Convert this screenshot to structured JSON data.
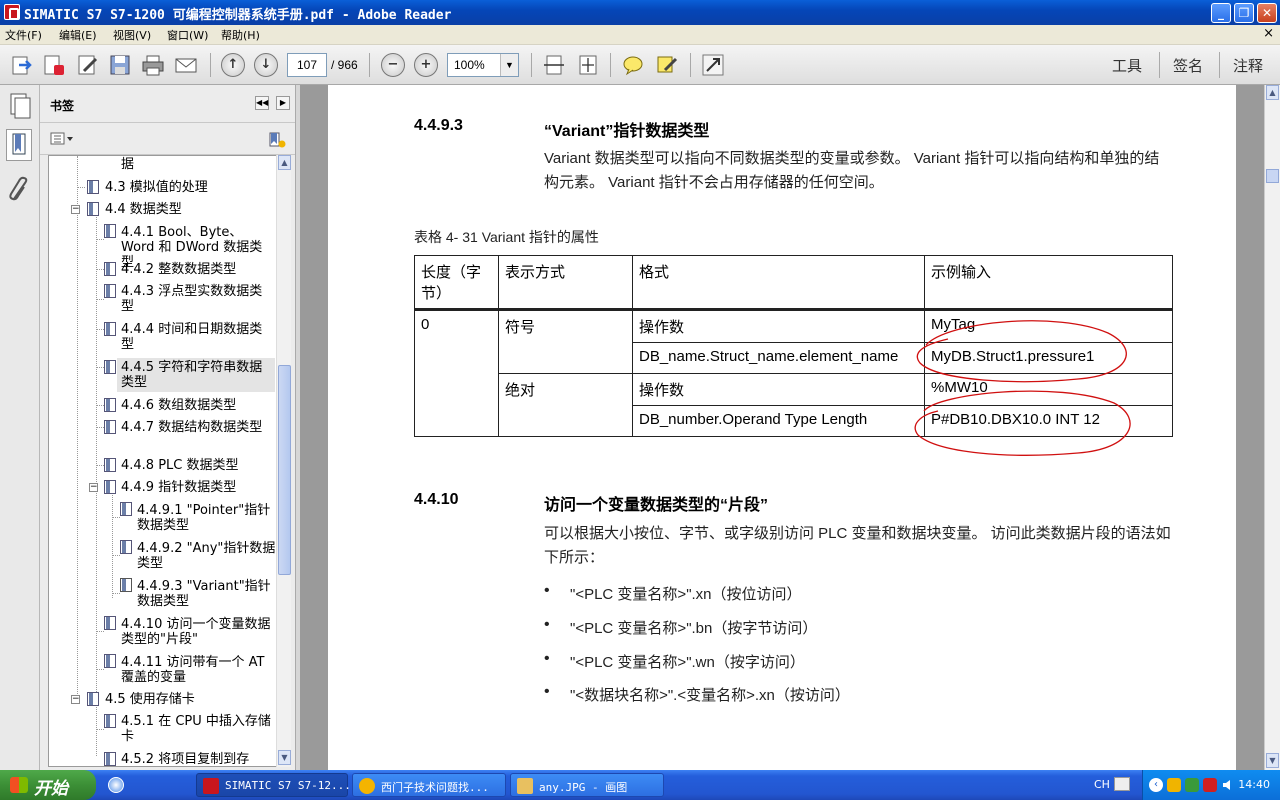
{
  "window": {
    "title": "SIMATIC S7 S7-1200 可编程控制器系统手册.pdf - Adobe Reader",
    "minimize": "_",
    "maximize": "❐",
    "close": "✕"
  },
  "menu": {
    "items": [
      "文件(F)",
      "编辑(E)",
      "视图(V)",
      "窗口(W)",
      "帮助(H)"
    ],
    "doc_close": "×"
  },
  "toolbar": {
    "page_current": "107",
    "page_total": "/ 966",
    "zoom": "100%",
    "tools": "工具",
    "sign": "签名",
    "comment": "注释"
  },
  "bookmarks": {
    "title": "书签",
    "items": [
      "据",
      "4.3 模拟值的处理",
      "4.4 数据类型",
      "4.4.1 Bool、Byte、Word 和 DWord 数据类型",
      "4.4.2 整数数据类型",
      "4.4.3 浮点型实数数据类型",
      "4.4.4 时间和日期数据类型",
      "4.4.5 字符和字符串数据类型",
      "4.4.6 数组数据类型",
      "4.4.7 数据结构数据类型",
      "4.4.8 PLC 数据类型",
      "4.4.9 指针数据类型",
      "4.4.9.1 \"Pointer\"指针数据类型",
      "4.4.9.2 \"Any\"指针数据类型",
      "4.4.9.3 \"Variant\"指针数据类型",
      "4.4.10 访问一个变量数据类型的\"片段\"",
      "4.4.11 访问带有一个 AT 覆盖的变量",
      "4.5 使用存储卡",
      "4.5.1 在 CPU 中插入存储卡",
      "4.5.2 将项目复制到存"
    ]
  },
  "document": {
    "section1_num": "4.4.9.3",
    "section1_title": "“Variant”指针数据类型",
    "section1_text": "Variant 数据类型可以指向不同数据类型的变量或参数。 Variant 指针可以指向结构和单独的结构元素。 Variant 指针不会占用存储器的任何空间。",
    "table_caption": "表格 4- 31    Variant 指针的属性",
    "table": {
      "headers": [
        "长度（字节）",
        "表示方式",
        "格式",
        "示例输入"
      ],
      "length": "0",
      "rep_symbol": "符号",
      "rep_absolute": "绝对",
      "rows": [
        {
          "format": "操作数",
          "example": "MyTag"
        },
        {
          "format": "DB_name.Struct_name.element_name",
          "example": "MyDB.Struct1.pressure1"
        },
        {
          "format": "操作数",
          "example": "%MW10"
        },
        {
          "format": "DB_number.Operand Type Length",
          "example": "P#DB10.DBX10.0 INT 12"
        }
      ]
    },
    "section2_num": "4.4.10",
    "section2_title": "访问一个变量数据类型的“片段”",
    "section2_text": "可以根据大小按位、字节、或字级别访问 PLC 变量和数据块变量。 访问此类数据片段的语法如下所示：",
    "bullets": [
      "\"<PLC 变量名称>\".xn（按位访问）",
      "\"<PLC 变量名称>\".bn（按字节访问）",
      "\"<PLC 变量名称>\".wn（按字访问）",
      "\"<数据块名称>\".<变量名称>.xn（按访问）"
    ]
  },
  "taskbar": {
    "start": "开始",
    "tasks": [
      "SIMATIC S7 S7-12...",
      "西门子技术问题找...",
      "any.JPG - 画图"
    ],
    "lang": "CH",
    "clock": "14:40"
  },
  "colors": {
    "annotation": "#d01010",
    "titlebar": "#0546b8",
    "taskbar": "#245edb"
  }
}
